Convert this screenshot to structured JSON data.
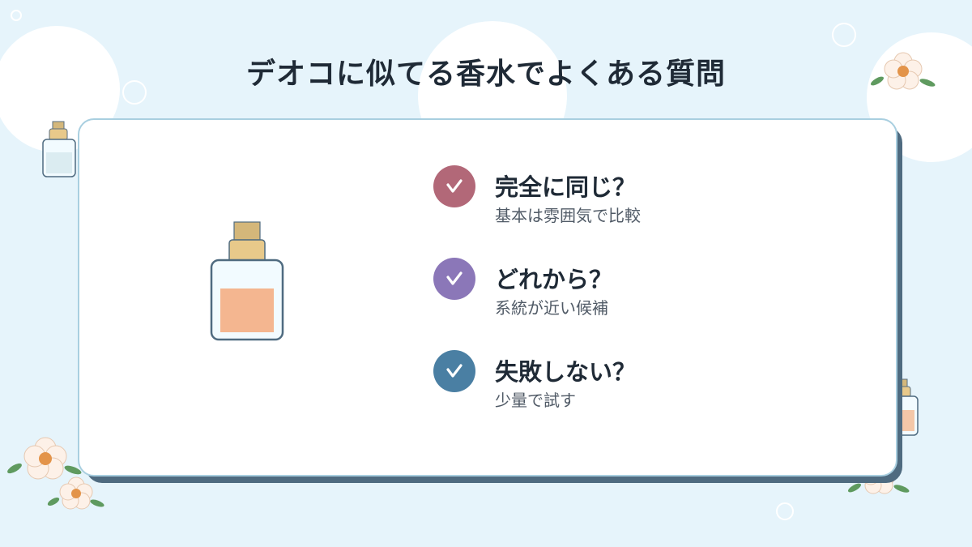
{
  "title": "デオコに似てる香水でよくある質問",
  "colors": {
    "background": "#e6f4fb",
    "card": "#ffffff",
    "card_shadow": "#4f6b80",
    "title_text": "#1f2a36"
  },
  "faq": [
    {
      "question": "完全に同じ？",
      "answer": "基本は雰囲気で比較",
      "icon": "check-icon",
      "color": "#b26878"
    },
    {
      "question": "どれから？",
      "answer": "系統が近い候補",
      "icon": "check-icon",
      "color": "#8b77b8"
    },
    {
      "question": "失敗しない？",
      "answer": "少量で試す",
      "icon": "check-icon",
      "color": "#4a7fa3"
    }
  ],
  "decorations": [
    "perfume-bottle-icon",
    "flower-icon",
    "bubble-icon"
  ]
}
